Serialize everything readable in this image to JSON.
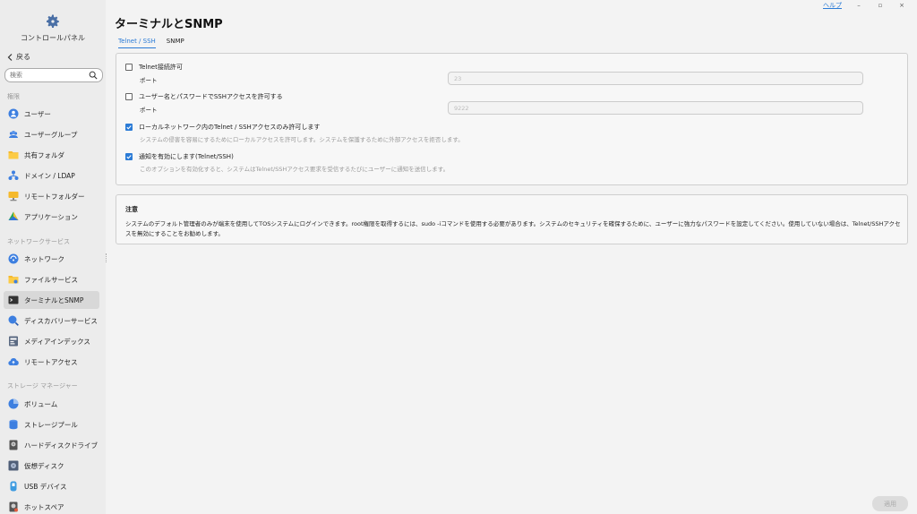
{
  "sidebar": {
    "title": "コントロールパネル",
    "back_label": "戻る",
    "search_placeholder": "検索",
    "sections": [
      {
        "label": "権限"
      },
      {
        "label": "ネットワークサービス"
      },
      {
        "label": "ストレージ マネージャー"
      }
    ],
    "items": [
      {
        "label": "ユーザー",
        "icon": "user-icon"
      },
      {
        "label": "ユーザーグループ",
        "icon": "user-group-icon"
      },
      {
        "label": "共有フォルダ",
        "icon": "folder-icon"
      },
      {
        "label": "ドメイン / LDAP",
        "icon": "domain-icon"
      },
      {
        "label": "リモートフォルダー",
        "icon": "remote-folder-icon"
      },
      {
        "label": "アプリケーション",
        "icon": "application-icon"
      },
      {
        "label": "ネットワーク",
        "icon": "network-icon"
      },
      {
        "label": "ファイルサービス",
        "icon": "file-service-icon"
      },
      {
        "label": "ターミナルとSNMP",
        "icon": "terminal-icon"
      },
      {
        "label": "ディスカバリーサービス",
        "icon": "discovery-icon"
      },
      {
        "label": "メディアインデックス",
        "icon": "media-index-icon"
      },
      {
        "label": "リモートアクセス",
        "icon": "remote-access-icon"
      },
      {
        "label": "ボリューム",
        "icon": "volume-icon"
      },
      {
        "label": "ストレージプール",
        "icon": "storage-pool-icon"
      },
      {
        "label": "ハードディスクドライブ",
        "icon": "hard-disk-icon"
      },
      {
        "label": "仮想ディスク",
        "icon": "virtual-disk-icon"
      },
      {
        "label": "USB デバイス",
        "icon": "usb-icon"
      },
      {
        "label": "ホットスペア",
        "icon": "hot-spare-icon"
      }
    ]
  },
  "topbar": {
    "help": "ヘルプ",
    "minimize": "–",
    "maximize": "▫",
    "close": "×"
  },
  "page": {
    "title": "ターミナルとSNMP",
    "tabs": [
      {
        "label": "Telnet / SSH",
        "active": true
      },
      {
        "label": "SNMP",
        "active": false
      }
    ]
  },
  "settings": {
    "telnet": {
      "label": "Telnet接続許可",
      "checked": false,
      "port_label": "ポート",
      "port_value": "23"
    },
    "ssh": {
      "label": "ユーザー名とパスワードでSSHアクセスを許可する",
      "checked": false,
      "port_label": "ポート",
      "port_value": "9222"
    },
    "local_only": {
      "label": "ローカルネットワーク内のTelnet / SSHアクセスのみ許可します",
      "checked": true,
      "hint": "システムの侵害を容易にするためにローカルアクセスを許可します。システムを保護するために外部アクセスを拒否します。"
    },
    "notify": {
      "label": "通知を有効にします(Telnet/SSH)",
      "checked": true,
      "hint": "このオプションを有効化すると、システムはTelnet/SSHアクセス要求を受信するたびにユーザーに通知を送信します。"
    }
  },
  "note": {
    "title": "注意",
    "body": "システムのデフォルト管理者のみが端末を使用してTOSシステムにログインできます。root権限を取得するには、sudo -iコマンドを使用する必要があります。システムのセキュリティを確保するために、ユーザーに強力なパスワードを設定してください。使用していない場合は、Telnet/SSHアクセスを無効にすることをお勧めします。"
  },
  "footer": {
    "apply_label": "適用"
  },
  "colors": {
    "accent": "#2b7bd6",
    "active_item_bg": "#d8d8d8"
  }
}
